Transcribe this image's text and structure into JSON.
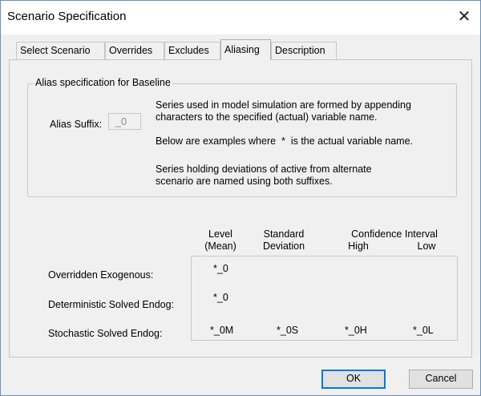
{
  "window": {
    "title": "Scenario Specification",
    "close_glyph": "✕"
  },
  "tabs": [
    {
      "label": "Select Scenario",
      "active": false
    },
    {
      "label": "Overrides",
      "active": false
    },
    {
      "label": "Excludes",
      "active": false
    },
    {
      "label": "Aliasing",
      "active": true
    },
    {
      "label": "Description",
      "active": false
    }
  ],
  "alias_group": {
    "legend": "Alias specification for Baseline",
    "suffix_label": "Alias Suffix:",
    "suffix_value": "_0",
    "desc1": "Series used in model simulation are formed by appending\ncharacters to the specified (actual) variable name.",
    "desc2": "Below are examples where  *  is the actual variable name.",
    "desc3": "Series holding deviations of active from alternate\nscenario are named using both suffixes."
  },
  "columns": {
    "level": "Level\n(Mean)",
    "std": "Standard\nDeviation",
    "ci": "Confidence Interval",
    "high": "High",
    "low": "Low"
  },
  "rows": [
    {
      "label": "Overridden Exogenous:",
      "level": "*_0",
      "std": "",
      "high": "",
      "low": ""
    },
    {
      "label": "Deterministic Solved Endog:",
      "level": "*_0",
      "std": "",
      "high": "",
      "low": ""
    },
    {
      "label": "Stochastic Solved Endog:",
      "level": "*_0M",
      "std": "*_0S",
      "high": "*_0H",
      "low": "*_0L"
    }
  ],
  "buttons": {
    "ok": "OK",
    "cancel": "Cancel"
  }
}
